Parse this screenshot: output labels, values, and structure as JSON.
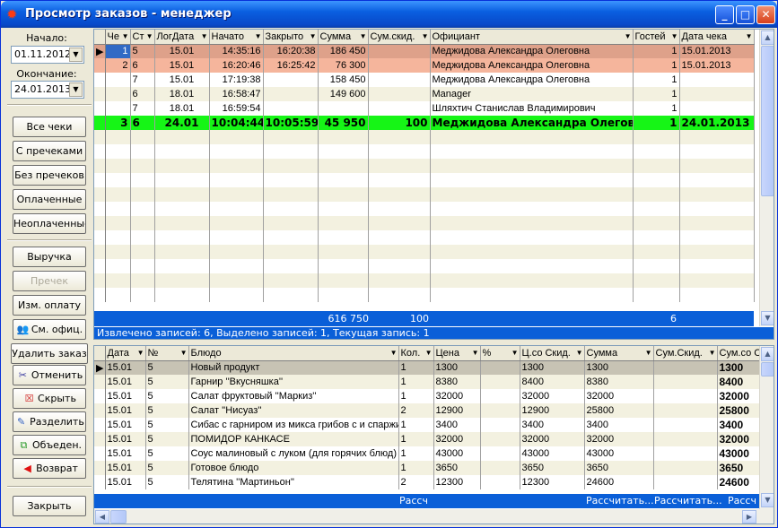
{
  "window": {
    "title": "Просмотр заказов - менеджер",
    "icon": "gear-icon",
    "minimize": "_",
    "maximize": "□",
    "close": "✕"
  },
  "filters": {
    "start_label": "Начало:",
    "start_value": "01.11.2012",
    "end_label": "Окончание:",
    "end_value": "24.01.2013"
  },
  "buttons": {
    "all_checks": "Все чеки",
    "with_precheck": "С пречеками",
    "no_precheck": "Без пречеков",
    "paid": "Оплаченные",
    "unpaid": "Неоплаченные",
    "revenue": "Выручка",
    "precheck": "Пречек",
    "change_payment": "Изм. оплату",
    "see_waiter": "См. офиц.",
    "delete_order": "Удалить заказ",
    "cancel": "Отменить",
    "hide": "Скрыть",
    "split": "Разделить",
    "merge": "Объеден.",
    "return": "Возврат",
    "close": "Закрыть"
  },
  "orders": {
    "columns": [
      "Че",
      "Ст",
      "ЛогДата",
      "Начато",
      "Закрыто",
      "Сумма",
      "Сум.скид.",
      "Официант",
      "Гостей",
      "Дата чека"
    ],
    "rows": [
      [
        "1",
        "5",
        "15.01",
        "14:35:16",
        "16:20:38",
        "186 450",
        "",
        "Меджидова Александра Олеговна",
        "1",
        "15.01.2013"
      ],
      [
        "2",
        "6",
        "15.01",
        "16:20:46",
        "16:25:42",
        "76 300",
        "",
        "Меджидова Александра Олеговна",
        "1",
        "15.01.2013"
      ],
      [
        "",
        "7",
        "15.01",
        "17:19:38",
        "",
        "158 450",
        "",
        "Меджидова Александра Олеговна",
        "1",
        ""
      ],
      [
        "",
        "6",
        "18.01",
        "16:58:47",
        "",
        "149 600",
        "",
        "Manager",
        "1",
        ""
      ],
      [
        "",
        "7",
        "18.01",
        "16:59:54",
        "",
        "",
        "",
        "Шляхтич Станислав Владимирович",
        "1",
        ""
      ],
      [
        "3",
        "6",
        "24.01",
        "10:04:44",
        "10:05:59",
        "45 950",
        "100",
        "Меджидова Александра Олеговна",
        "1",
        "24.01.2013"
      ]
    ],
    "totals": {
      "sum": "616 750",
      "discount": "100",
      "guests": "6"
    },
    "status": "Извлечено записей: 6, Выделено записей: 1, Текущая запись: 1"
  },
  "items": {
    "columns": [
      "Дата",
      "№",
      "Блюдо",
      "Кол.",
      "Цена",
      "%",
      "Ц.со Скид.",
      "Сумма",
      "Сум.Скид.",
      "Сум.со Ск"
    ],
    "rows": [
      [
        "15.01",
        "5",
        "Новый продукт",
        "1",
        "1300",
        "",
        "1300",
        "1300",
        "",
        "1300"
      ],
      [
        "15.01",
        "5",
        "Гарнир ''Вкусняшка''",
        "1",
        "8380",
        "",
        "8400",
        "8380",
        "",
        "8400"
      ],
      [
        "15.01",
        "5",
        "Салат фруктовый ''Маркиз''",
        "1",
        "32000",
        "",
        "32000",
        "32000",
        "",
        "32000"
      ],
      [
        "15.01",
        "5",
        "Салат ''Нисуаз''",
        "2",
        "12900",
        "",
        "12900",
        "25800",
        "",
        "25800"
      ],
      [
        "15.01",
        "5",
        "Сибас с гарниром из микса грибов с и спаржи",
        "1",
        "3400",
        "",
        "3400",
        "3400",
        "",
        "3400"
      ],
      [
        "15.01",
        "5",
        "ПОМИДОР КАНКАСЕ",
        "1",
        "32000",
        "",
        "32000",
        "32000",
        "",
        "32000"
      ],
      [
        "15.01",
        "5",
        "Соус малиновый с луком (для горячих блюд)",
        "1",
        "43000",
        "",
        "43000",
        "43000",
        "",
        "43000"
      ],
      [
        "15.01",
        "5",
        "Готовое блюдо",
        "1",
        "3650",
        "",
        "3650",
        "3650",
        "",
        "3650"
      ],
      [
        "15.01",
        "5",
        "Телятина ''Мартиньон''",
        "2",
        "12300",
        "",
        "12300",
        "24600",
        "",
        "24600"
      ]
    ],
    "footer": {
      "qty": "Рассч",
      "sum": "Рассчитать...",
      "disc": "Рассчитать...",
      "total": "Рассч"
    }
  }
}
